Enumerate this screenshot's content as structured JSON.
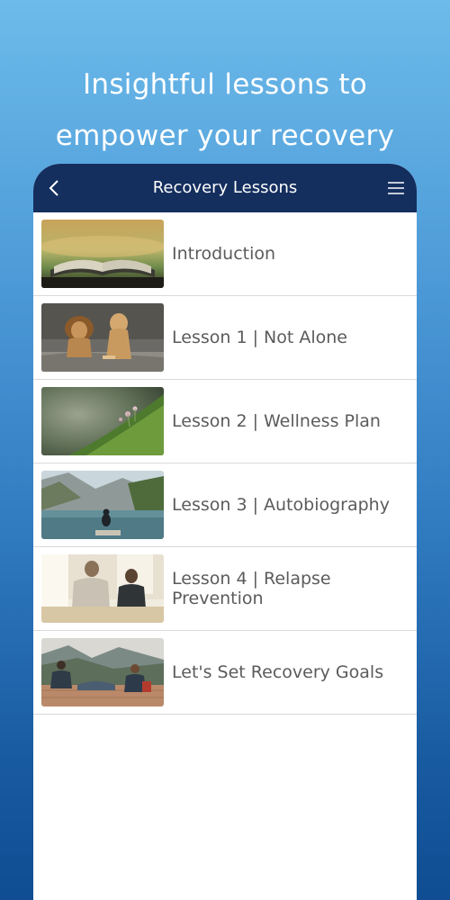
{
  "headline": {
    "line1": "Insightful lessons to",
    "line2": "empower your recovery"
  },
  "appbar": {
    "title": "Recovery Lessons",
    "back_icon": "chevron-left-icon",
    "menu_icon": "hamburger-menu-icon",
    "background": "#142e5e"
  },
  "lessons": [
    {
      "label": "Introduction",
      "thumbnail": "open-book-image"
    },
    {
      "label": "Lesson 1 | Not Alone",
      "thumbnail": "lions-image"
    },
    {
      "label": "Lesson 2 | Wellness Plan",
      "thumbnail": "moss-sprout-image"
    },
    {
      "label": "Lesson 3 | Autobiography",
      "thumbnail": "mountain-lake-image"
    },
    {
      "label": "Lesson 4 | Relapse\nPrevention",
      "thumbnail": "people-talking-image"
    },
    {
      "label": "Let's Set Recovery Goals",
      "thumbnail": "friends-mountain-image"
    }
  ]
}
